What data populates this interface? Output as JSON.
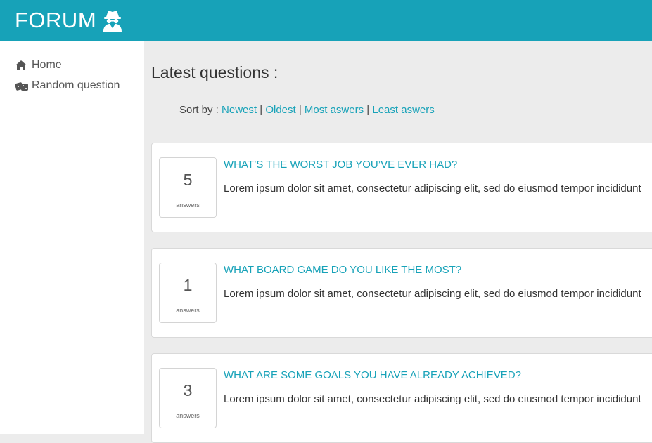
{
  "header": {
    "brand": "FORUM",
    "brand_icon": "user-secret-icon",
    "color": "#17a2b8"
  },
  "sidebar": {
    "items": [
      {
        "label": "Home",
        "icon": "home-icon"
      },
      {
        "label": "Random question",
        "icon": "dice-icon"
      }
    ]
  },
  "main": {
    "title": "Latest questions :",
    "sort": {
      "prefix": "Sort by :",
      "options": [
        "Newest",
        "Oldest",
        "Most aswers",
        "Least aswers"
      ],
      "separator": "|"
    },
    "questions": [
      {
        "answers": "5",
        "answers_label": "answers",
        "title": "What’s the worst job you’ve ever had?",
        "excerpt": "Lorem ipsum dolor sit amet, consectetur adipiscing elit, sed do eiusmod tempor incididunt"
      },
      {
        "answers": "1",
        "answers_label": "answers",
        "title": "What board game do you like the most?",
        "excerpt": "Lorem ipsum dolor sit amet, consectetur adipiscing elit, sed do eiusmod tempor incididunt"
      },
      {
        "answers": "3",
        "answers_label": "answers",
        "title": "What are some goals you have already achieved?",
        "excerpt": "Lorem ipsum dolor sit amet, consectetur adipiscing elit, sed do eiusmod tempor incididunt"
      }
    ]
  }
}
